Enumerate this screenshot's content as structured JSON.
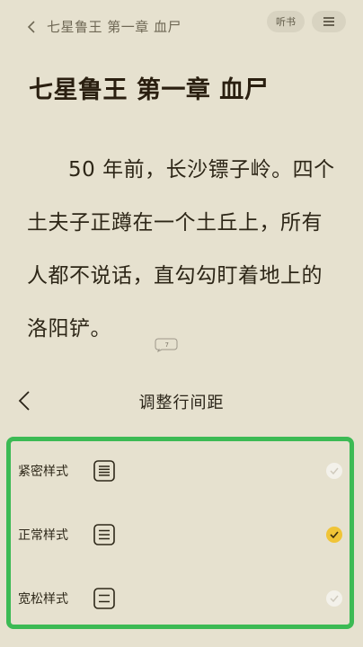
{
  "topbar": {
    "chapter": "七星鲁王 第一章 血尸",
    "listen_label": "听书",
    "menu_icon": "hamburger-menu-icon",
    "back_icon": "chevron-left-icon"
  },
  "content": {
    "title": "七星鲁王 第一章 血尸",
    "paragraph": "50 年前，长沙镖子岭。四个土夫子正蹲在一个土丘上，所有人都不说话，直勾勾盯着地上的洛阳铲。",
    "comment_count": "7"
  },
  "panel": {
    "title": "调整行间距",
    "options": [
      {
        "label": "紧密样式",
        "icon": "dense-lines-icon",
        "selected": false
      },
      {
        "label": "正常样式",
        "icon": "normal-lines-icon",
        "selected": true
      },
      {
        "label": "宽松样式",
        "icon": "loose-lines-icon",
        "selected": false
      }
    ]
  },
  "colors": {
    "background": "#e6e1cf",
    "highlight_border": "#3cba54",
    "selected_radio": "#f0c437",
    "unselected_radio": "#f3f1ea"
  }
}
